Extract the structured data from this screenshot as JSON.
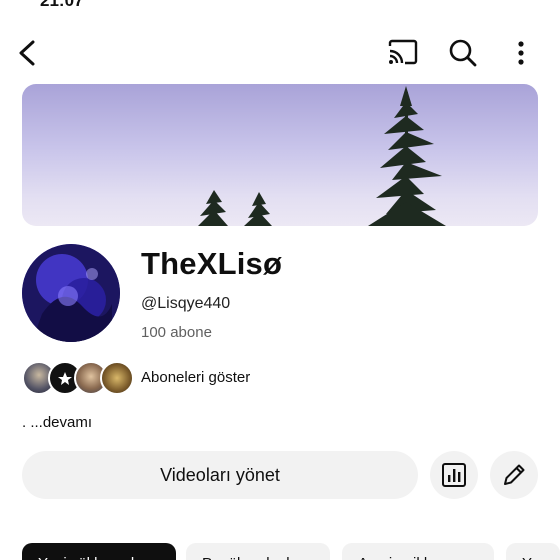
{
  "status_bar": {
    "time": "21:07"
  },
  "top_bar": {
    "back_icon": "chevron-left-icon",
    "cast_icon": "cast-icon",
    "search_icon": "search-icon",
    "more_icon": "more-vert-icon"
  },
  "channel": {
    "name": "TheXLisø",
    "handle": "@Lisqye440",
    "subscribers": "100 abone",
    "show_subscribers": "Aboneleri göster",
    "description": ". ...devamı"
  },
  "actions": {
    "manage_videos": "Videoları yönet",
    "analytics_icon": "analytics-icon",
    "edit_icon": "edit-pencil-icon"
  },
  "chips": [
    {
      "label": "Yeni yüklenenler",
      "active": true
    },
    {
      "label": "Popüler olanlar",
      "active": false
    },
    {
      "label": "Ana içerikler",
      "active": false
    },
    {
      "label": "Yay",
      "active": false
    }
  ],
  "colors": {
    "banner_top": "#a9a3d8",
    "banner_bottom": "#ece8f4",
    "button_bg": "#f2f2f2",
    "chip_active_bg": "#0f0f0f"
  }
}
